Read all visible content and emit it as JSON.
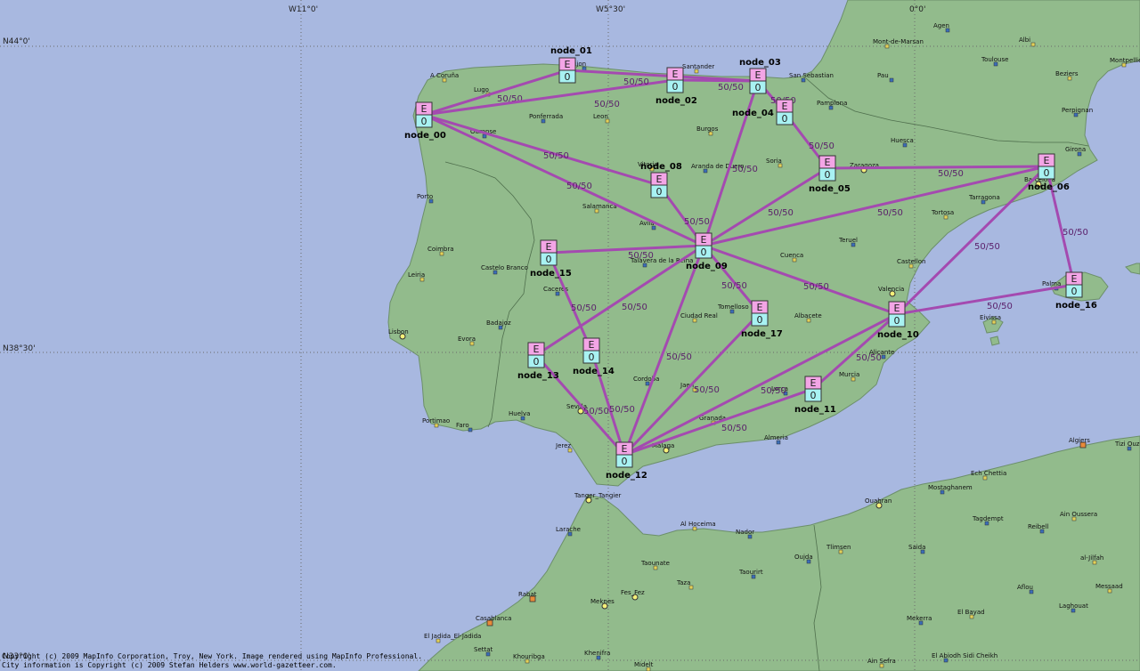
{
  "map": {
    "graticule": {
      "lon_labels": [
        "W11°0'",
        "W5°30'",
        "0°0'"
      ],
      "lat_labels": [
        "N44°0'",
        "N38°30'",
        "N33°0'"
      ]
    },
    "copyright": [
      "Copyright (c) 2009 MapInfo Corporation, Troy, New York. Image rendered using MapInfo Professional.",
      "City information is Copyright (c) 2009 Stefan Helders www.world-gazetteer.com."
    ]
  },
  "colors": {
    "sea": "#a8b8e0",
    "land": "#92bb8c",
    "link": "#a44ab0",
    "node_top": "#f3a5e6",
    "node_bottom": "#a8f2f2"
  },
  "nodes": [
    {
      "id": "node_00",
      "top": "E",
      "bottom": "0"
    },
    {
      "id": "node_01",
      "top": "E",
      "bottom": "0"
    },
    {
      "id": "node_02",
      "top": "E",
      "bottom": "0"
    },
    {
      "id": "node_03",
      "top": "E",
      "bottom": "0"
    },
    {
      "id": "node_04",
      "top": "E",
      "bottom": "0"
    },
    {
      "id": "node_05",
      "top": "E",
      "bottom": "0"
    },
    {
      "id": "node_06",
      "top": "E",
      "bottom": "0"
    },
    {
      "id": "node_08",
      "top": "E",
      "bottom": "0"
    },
    {
      "id": "node_09",
      "top": "E",
      "bottom": "0"
    },
    {
      "id": "node_10",
      "top": "E",
      "bottom": "0"
    },
    {
      "id": "node_11",
      "top": "E",
      "bottom": "0"
    },
    {
      "id": "node_12",
      "top": "E",
      "bottom": "0"
    },
    {
      "id": "node_13",
      "top": "E",
      "bottom": "0"
    },
    {
      "id": "node_14",
      "top": "E",
      "bottom": "0"
    },
    {
      "id": "node_15",
      "top": "E",
      "bottom": "0"
    },
    {
      "id": "node_16",
      "top": "E",
      "bottom": "0"
    },
    {
      "id": "node_17",
      "top": "E",
      "bottom": "0"
    }
  ],
  "links": [
    {
      "from": "node_00",
      "to": "node_01",
      "label": "50/50"
    },
    {
      "from": "node_00",
      "to": "node_02",
      "label": "50/50"
    },
    {
      "from": "node_00",
      "to": "node_08",
      "label": "50/50"
    },
    {
      "from": "node_00",
      "to": "node_09",
      "label": "50/50"
    },
    {
      "from": "node_01",
      "to": "node_03",
      "label": "50/50"
    },
    {
      "from": "node_02",
      "to": "node_03",
      "label": "50/50"
    },
    {
      "from": "node_03",
      "to": "node_04",
      "label": "50/50"
    },
    {
      "from": "node_03",
      "to": "node_09",
      "label": "50/50"
    },
    {
      "from": "node_04",
      "to": "node_05",
      "label": "50/50"
    },
    {
      "from": "node_05",
      "to": "node_06",
      "label": "50/50"
    },
    {
      "from": "node_05",
      "to": "node_09",
      "label": "50/50"
    },
    {
      "from": "node_06",
      "to": "node_09",
      "label": "50/50"
    },
    {
      "from": "node_06",
      "to": "node_10",
      "label": "50/50"
    },
    {
      "from": "node_06",
      "to": "node_16",
      "label": "50/50"
    },
    {
      "from": "node_08",
      "to": "node_09",
      "label": "50/50"
    },
    {
      "from": "node_09",
      "to": "node_15",
      "label": "50/50"
    },
    {
      "from": "node_09",
      "to": "node_13",
      "label": "50/50"
    },
    {
      "from": "node_09",
      "to": "node_17",
      "label": "50/50"
    },
    {
      "from": "node_09",
      "to": "node_10",
      "label": "50/50"
    },
    {
      "from": "node_09",
      "to": "node_12",
      "label": "50/50"
    },
    {
      "from": "node_10",
      "to": "node_16",
      "label": "50/50"
    },
    {
      "from": "node_10",
      "to": "node_11",
      "label": "50/50"
    },
    {
      "from": "node_10",
      "to": "node_12",
      "label": "50/50"
    },
    {
      "from": "node_11",
      "to": "node_12",
      "label": "50/50"
    },
    {
      "from": "node_17",
      "to": "node_12",
      "label": "50/50"
    },
    {
      "from": "node_15",
      "to": "node_14",
      "label": "50/50"
    },
    {
      "from": "node_14",
      "to": "node_12",
      "label": "50/50"
    },
    {
      "from": "node_13",
      "to": "node_12",
      "label": "50/50"
    }
  ],
  "cities": [
    {
      "name": "A Coruña",
      "marker": "dot"
    },
    {
      "name": "Gijon",
      "marker": "dot"
    },
    {
      "name": "Santander",
      "marker": "dot"
    },
    {
      "name": "San Sebastian",
      "marker": "dot"
    },
    {
      "name": "Lugo",
      "marker": "dot"
    },
    {
      "name": "Ponferrada",
      "marker": "dot"
    },
    {
      "name": "Leon",
      "marker": "dot"
    },
    {
      "name": "Ourense",
      "marker": "dot"
    },
    {
      "name": "Burgos",
      "marker": "dot"
    },
    {
      "name": "Pamplona",
      "marker": "dot"
    },
    {
      "name": "Vitoria",
      "marker": "dot"
    },
    {
      "name": "Aranda de Duero",
      "marker": "dot"
    },
    {
      "name": "Soria",
      "marker": "dot"
    },
    {
      "name": "Huesca",
      "marker": "dot"
    },
    {
      "name": "Zaragoza",
      "marker": "ring"
    },
    {
      "name": "Girona",
      "marker": "dot"
    },
    {
      "name": "Barcelona",
      "marker": "ring"
    },
    {
      "name": "Tarragona",
      "marker": "dot"
    },
    {
      "name": "Tortosa",
      "marker": "dot"
    },
    {
      "name": "Porto",
      "marker": "dot"
    },
    {
      "name": "Salamanca",
      "marker": "dot"
    },
    {
      "name": "Avila",
      "marker": "dot"
    },
    {
      "name": "Coimbra",
      "marker": "dot"
    },
    {
      "name": "Castelo Branco",
      "marker": "dot"
    },
    {
      "name": "Leiria",
      "marker": "dot"
    },
    {
      "name": "Talavera de la Reina",
      "marker": "dot"
    },
    {
      "name": "Cuenca",
      "marker": "dot"
    },
    {
      "name": "Teruel",
      "marker": "dot"
    },
    {
      "name": "Castellon",
      "marker": "dot"
    },
    {
      "name": "Caceres",
      "marker": "dot"
    },
    {
      "name": "Valencia",
      "marker": "ring"
    },
    {
      "name": "Palma",
      "marker": "dot"
    },
    {
      "name": "Eivissa",
      "marker": "dot"
    },
    {
      "name": "Badajoz",
      "marker": "dot"
    },
    {
      "name": "Ciudad Real",
      "marker": "dot"
    },
    {
      "name": "Tomelloso",
      "marker": "dot"
    },
    {
      "name": "Albacete",
      "marker": "dot"
    },
    {
      "name": "Lisbon",
      "marker": "ring"
    },
    {
      "name": "Evora",
      "marker": "dot"
    },
    {
      "name": "Alicante",
      "marker": "dot"
    },
    {
      "name": "Murcia",
      "marker": "dot"
    },
    {
      "name": "Cordoba",
      "marker": "dot"
    },
    {
      "name": "Jaen",
      "marker": "dot"
    },
    {
      "name": "Lorca",
      "marker": "dot"
    },
    {
      "name": "Sevilla",
      "marker": "ring"
    },
    {
      "name": "Huelva",
      "marker": "dot"
    },
    {
      "name": "Portimao",
      "marker": "dot"
    },
    {
      "name": "Faro",
      "marker": "dot"
    },
    {
      "name": "Granada",
      "marker": "dot"
    },
    {
      "name": "Almeria",
      "marker": "dot"
    },
    {
      "name": "Jerez",
      "marker": "dot"
    },
    {
      "name": "Malaga",
      "marker": "ring"
    },
    {
      "name": "Mont-de-Marsan",
      "marker": "dot"
    },
    {
      "name": "Agen",
      "marker": "dot"
    },
    {
      "name": "Albi",
      "marker": "dot"
    },
    {
      "name": "Toulouse",
      "marker": "dot"
    },
    {
      "name": "Montpellier",
      "marker": "dot"
    },
    {
      "name": "Pau",
      "marker": "dot"
    },
    {
      "name": "Beziers",
      "marker": "dot"
    },
    {
      "name": "Perpignan",
      "marker": "dot"
    },
    {
      "name": "Algiers",
      "marker": "square"
    },
    {
      "name": "Tizi Ouzou",
      "marker": "dot"
    },
    {
      "name": "Ech Chettia",
      "marker": "dot"
    },
    {
      "name": "Mostaghanem",
      "marker": "dot"
    },
    {
      "name": "Ouahran",
      "marker": "ring"
    },
    {
      "name": "Tagdempt",
      "marker": "dot"
    },
    {
      "name": "Ain Oussera",
      "marker": "dot"
    },
    {
      "name": "Reibell",
      "marker": "dot"
    },
    {
      "name": "Tanger_Tangier",
      "marker": "ring"
    },
    {
      "name": "Larache",
      "marker": "dot"
    },
    {
      "name": "Al Hoceima",
      "marker": "dot"
    },
    {
      "name": "Nador",
      "marker": "dot"
    },
    {
      "name": "Tlimsen",
      "marker": "dot"
    },
    {
      "name": "Saida",
      "marker": "dot"
    },
    {
      "name": "al-Jilfah",
      "marker": "dot"
    },
    {
      "name": "Oujda",
      "marker": "dot"
    },
    {
      "name": "Taounate",
      "marker": "dot"
    },
    {
      "name": "Taourirt",
      "marker": "dot"
    },
    {
      "name": "Taza",
      "marker": "dot"
    },
    {
      "name": "Rabat",
      "marker": "square"
    },
    {
      "name": "Meknes",
      "marker": "ring"
    },
    {
      "name": "Fes_Fez",
      "marker": "ring"
    },
    {
      "name": "Casablanca",
      "marker": "square"
    },
    {
      "name": "Aflou",
      "marker": "dot"
    },
    {
      "name": "Messaad",
      "marker": "dot"
    },
    {
      "name": "Laghouat",
      "marker": "dot"
    },
    {
      "name": "El Bayad",
      "marker": "dot"
    },
    {
      "name": "Mekerra",
      "marker": "dot"
    },
    {
      "name": "El Jadida_El-Jadida",
      "marker": "dot"
    },
    {
      "name": "Settat",
      "marker": "dot"
    },
    {
      "name": "Khouribga",
      "marker": "dot"
    },
    {
      "name": "Khenifra",
      "marker": "dot"
    },
    {
      "name": "Midelt",
      "marker": "dot"
    },
    {
      "name": "El Abiodh Sidi Cheikh",
      "marker": "dot"
    },
    {
      "name": "Ain Sefra",
      "marker": "dot"
    }
  ]
}
